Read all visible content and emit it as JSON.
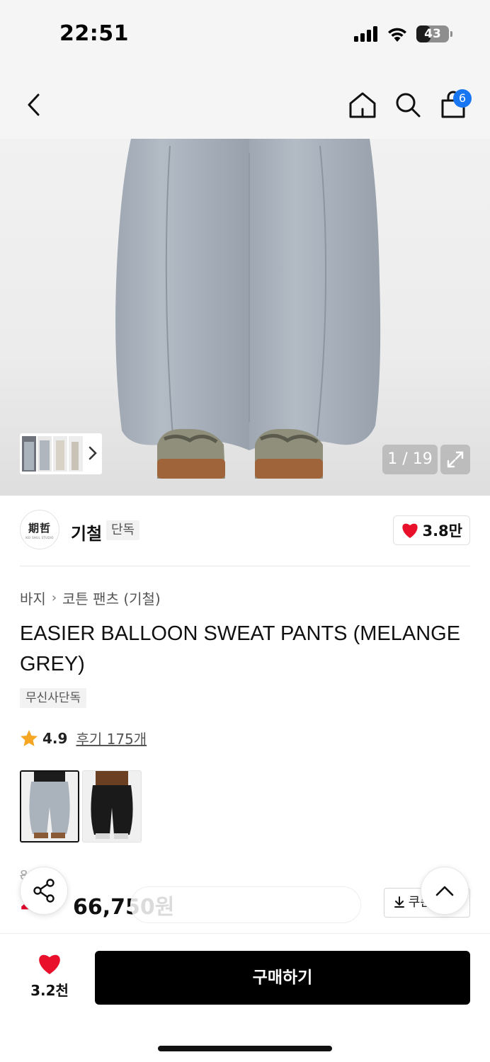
{
  "status_bar": {
    "time": "22:51",
    "battery": "43",
    "battery_level": 0.43
  },
  "nav": {
    "cart_count": "6"
  },
  "gallery": {
    "counter": "1 / 19"
  },
  "brand": {
    "logo_text": "期哲",
    "logo_sub": "KEI SHUL STUDIO",
    "name": "기철",
    "badge": "단독",
    "likes": "3.8만"
  },
  "breadcrumb": {
    "category": "바지",
    "subcategory": "코튼 팬츠 (기철)"
  },
  "product": {
    "title": "EASIER BALLOON SWEAT PANTS (MELANGE GREY)",
    "exclusive_tag": "무신사단독",
    "rating": "4.9",
    "review_link": "후기 175개"
  },
  "price": {
    "original": "8\t\t9원",
    "discount": "2",
    "sale": "66,750원",
    "promo_text": "",
    "coupon_label": "쿠폰"
  },
  "bottom_bar": {
    "wish_count": "3.2천",
    "buy_label": "구매하기"
  },
  "colors": {
    "accent": "#1976f2",
    "discount_red": "#e4002b",
    "heart_red": "#e8102a",
    "star": "#f5a623"
  }
}
